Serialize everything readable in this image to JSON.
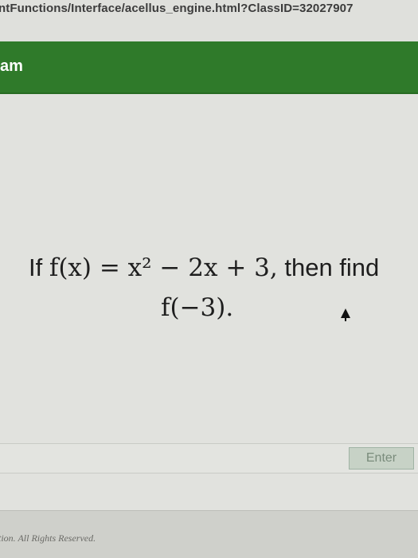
{
  "browser": {
    "url": "ntFunctions/Interface/acellus_engine.html?ClassID=32027907"
  },
  "header": {
    "title": "am",
    "bar_color": "#2f7a2a"
  },
  "question": {
    "line1_prefix": "If ",
    "line1_math": "f(x) = x² − 2x + 3,",
    "line1_suffix": " then find",
    "line2_math": "f(−3)."
  },
  "answer": {
    "value": "",
    "enter_label": "Enter"
  },
  "footer": {
    "text": "tion. All Rights Reserved."
  },
  "icons": {
    "cursor": "mouse-pointer-icon"
  }
}
